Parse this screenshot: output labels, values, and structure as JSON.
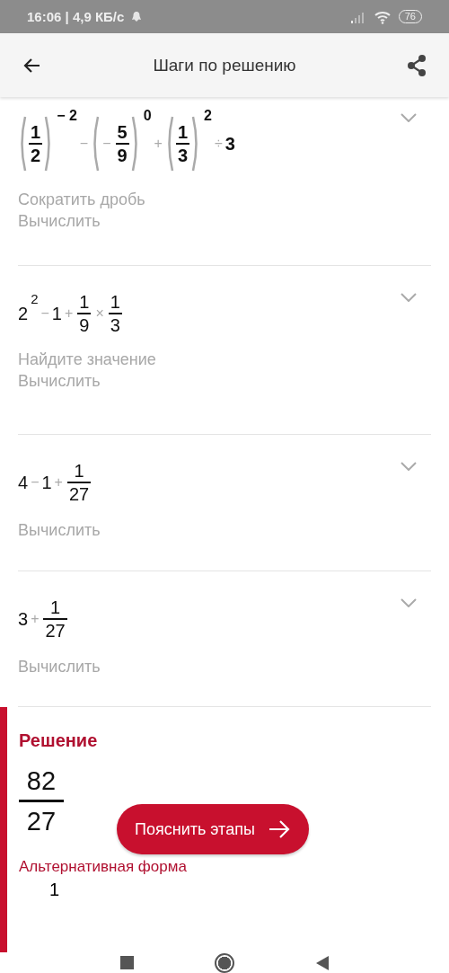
{
  "status_bar": {
    "time": "16:06 | 4,9 КБ/с",
    "battery": "76"
  },
  "app_bar": {
    "title": "Шаги по решению"
  },
  "steps": [
    {
      "bold": true,
      "expanded": false,
      "tokens": [
        {
          "kind": "paren",
          "num": "1",
          "den": "2",
          "exp": "− 2"
        },
        {
          "kind": "op",
          "text": "−"
        },
        {
          "kind": "paren",
          "sign": "−",
          "num": "5",
          "den": "9",
          "exp": "0"
        },
        {
          "kind": "op",
          "text": "+"
        },
        {
          "kind": "paren",
          "num": "1",
          "den": "3",
          "exp": "2"
        },
        {
          "kind": "op",
          "text": "÷"
        },
        {
          "kind": "num",
          "text": "3"
        }
      ],
      "hints": [
        "Сократить дробь",
        "Вычислить"
      ]
    },
    {
      "bold": false,
      "expanded": false,
      "tokens": [
        {
          "kind": "num",
          "text": "2",
          "exp": "2"
        },
        {
          "kind": "op",
          "text": "−"
        },
        {
          "kind": "num",
          "text": "1"
        },
        {
          "kind": "op",
          "text": "+"
        },
        {
          "kind": "frac",
          "num": "1",
          "den": "9"
        },
        {
          "kind": "op",
          "text": "×"
        },
        {
          "kind": "frac",
          "num": "1",
          "den": "3"
        }
      ],
      "hints": [
        "Найдите значение",
        "Вычислить"
      ]
    },
    {
      "bold": false,
      "expanded": false,
      "tokens": [
        {
          "kind": "num",
          "text": "4"
        },
        {
          "kind": "op",
          "text": "−"
        },
        {
          "kind": "num",
          "text": "1"
        },
        {
          "kind": "op",
          "text": "+"
        },
        {
          "kind": "frac",
          "num": "1",
          "den": "27"
        }
      ],
      "hints": [
        "Вычислить"
      ]
    },
    {
      "bold": false,
      "expanded": false,
      "tokens": [
        {
          "kind": "num",
          "text": "3"
        },
        {
          "kind": "op",
          "text": "+"
        },
        {
          "kind": "frac",
          "num": "1",
          "den": "27"
        }
      ],
      "hints": [
        "Вычислить"
      ]
    }
  ],
  "solution": {
    "title": "Решение",
    "num": "82",
    "den": "27",
    "alt_title": "Альтернативная форма",
    "alt_partial": "1"
  },
  "explain_button": {
    "label": "Пояснить этапы"
  }
}
